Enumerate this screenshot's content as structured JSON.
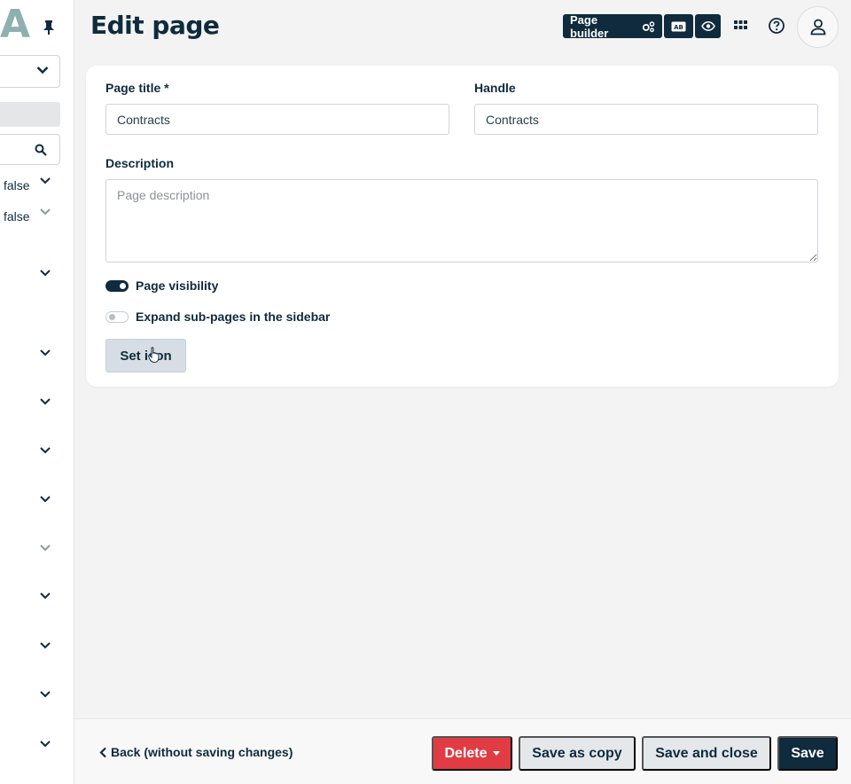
{
  "sidebar": {
    "logo_letter": "A",
    "false_values": [
      "false",
      "false"
    ]
  },
  "header": {
    "title": "Edit page",
    "page_builder_label": "Page builder"
  },
  "form": {
    "page_title_label": "Page title *",
    "page_title_value": "Contracts",
    "handle_label": "Handle",
    "handle_value": "Contracts",
    "description_label": "Description",
    "description_placeholder": "Page description",
    "page_visibility_label": "Page visibility",
    "page_visibility_on": true,
    "expand_subpages_label": "Expand sub-pages in the sidebar",
    "expand_subpages_on": false,
    "set_icon_label": "Set icon"
  },
  "footer": {
    "back_label": "Back (without saving changes)",
    "delete_label": "Delete",
    "save_copy_label": "Save as copy",
    "save_close_label": "Save and close",
    "save_label": "Save"
  },
  "colors": {
    "primary": "#0f2b3d",
    "danger": "#e13c43",
    "secondary": "#e5e8eb",
    "page_bg": "#f3f3f3"
  }
}
